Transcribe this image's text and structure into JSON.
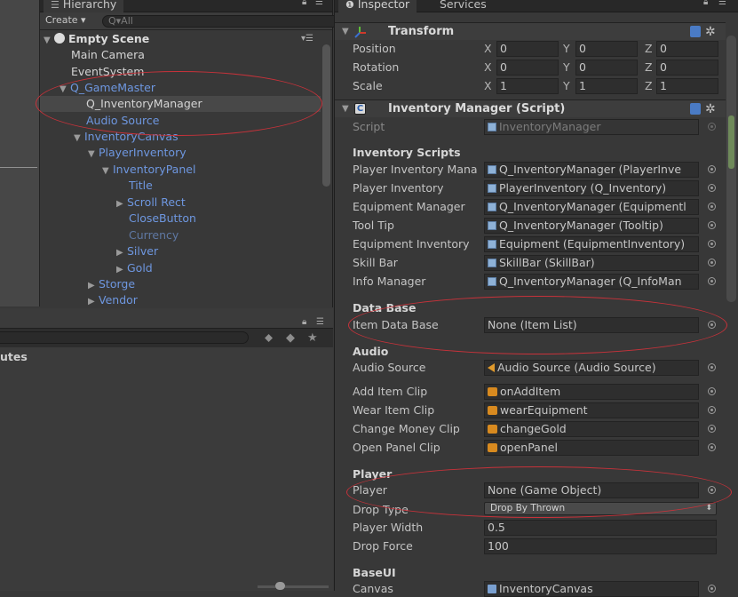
{
  "hierarchy": {
    "tab": "Hierarchy",
    "create": "Create ▾",
    "search_placeholder": "Q▾All",
    "scene": "Empty Scene",
    "items": [
      {
        "label": "Main Camera"
      },
      {
        "label": "EventSystem"
      },
      {
        "label": "Q_GameMaster"
      },
      {
        "label": "Q_InventoryManager"
      },
      {
        "label": "Audio Source"
      },
      {
        "label": "InventoryCanvas"
      },
      {
        "label": "PlayerInventory"
      },
      {
        "label": "InventoryPanel"
      },
      {
        "label": "Title"
      },
      {
        "label": "Scroll Rect"
      },
      {
        "label": "CloseButton"
      },
      {
        "label": "Currency"
      },
      {
        "label": "Silver"
      },
      {
        "label": "Gold"
      },
      {
        "label": "Storge"
      },
      {
        "label": "Vendor"
      }
    ]
  },
  "bottom_left": {
    "header": "utes"
  },
  "inspector": {
    "tabs": [
      "Inspector",
      "Services"
    ],
    "transform": {
      "title": "Transform",
      "rows": [
        {
          "label": "Position",
          "x": "0",
          "y": "0",
          "z": "0"
        },
        {
          "label": "Rotation",
          "x": "0",
          "y": "0",
          "z": "0"
        },
        {
          "label": "Scale",
          "x": "1",
          "y": "1",
          "z": "1"
        }
      ],
      "axis_x": "X",
      "axis_y": "Y",
      "axis_z": "Z"
    },
    "component": {
      "title": "Inventory Manager (Script)",
      "script_label": "Script",
      "script_value": "InventoryManager",
      "sections": {
        "inventory_scripts": "Inventory Scripts",
        "data_base": "Data Base",
        "audio": "Audio",
        "player": "Player",
        "baseui": "BaseUI"
      },
      "fields": {
        "player_inventory_manager": {
          "label": "Player Inventory Mana",
          "value": "Q_InventoryManager (PlayerInve"
        },
        "player_inventory": {
          "label": "Player Inventory",
          "value": "PlayerInventory (Q_Inventory)"
        },
        "equipment_manager": {
          "label": "Equipment Manager",
          "value": "Q_InventoryManager (Equipmentl"
        },
        "tool_tip": {
          "label": "Tool Tip",
          "value": "Q_InventoryManager (Tooltip)"
        },
        "equipment_inventory": {
          "label": "Equipment Inventory",
          "value": "Equipment (EquipmentInventory)"
        },
        "skill_bar": {
          "label": "Skill Bar",
          "value": "SkillBar (SkillBar)"
        },
        "info_manager": {
          "label": "Info Manager",
          "value": "Q_InventoryManager (Q_InfoMan"
        },
        "item_data_base": {
          "label": "Item Data Base",
          "value": "None (Item List)"
        },
        "audio_source": {
          "label": "Audio Source",
          "value": "Audio Source (Audio Source)"
        },
        "add_item_clip": {
          "label": "Add Item Clip",
          "value": "onAddItem"
        },
        "wear_item_clip": {
          "label": "Wear Item Clip",
          "value": "wearEquipment"
        },
        "change_money_clip": {
          "label": "Change Money Clip",
          "value": "changeGold"
        },
        "open_panel_clip": {
          "label": "Open Panel Clip",
          "value": "openPanel"
        },
        "player": {
          "label": "Player",
          "value": "None (Game Object)"
        },
        "drop_type": {
          "label": "Drop Type",
          "value": "Drop By Thrown"
        },
        "player_width": {
          "label": "Player Width",
          "value": "0.5"
        },
        "drop_force": {
          "label": "Drop Force",
          "value": "100"
        },
        "canvas": {
          "label": "Canvas",
          "value": "InventoryCanvas"
        }
      }
    }
  },
  "colors": {
    "panel_bg": "#383838",
    "selection_bg": "#484848",
    "prefab_blue": "#6e97e0",
    "annotation_red": "#c8323a"
  }
}
